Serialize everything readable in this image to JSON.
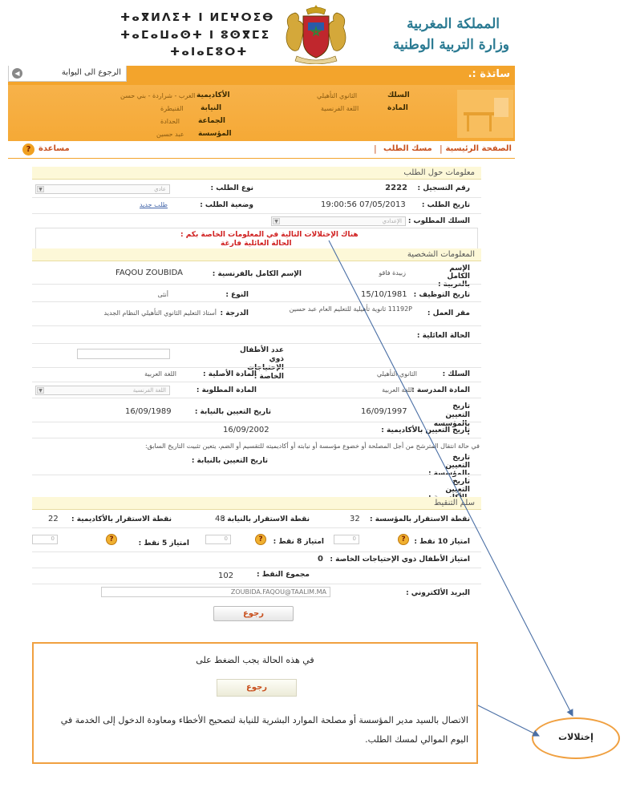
{
  "header": {
    "tifinagh_line1": "ⵜⴰⴳⵍⴷⵉⵜ ⵏ ⵍⵎⵖⵔⵉⴱ",
    "tifinagh_line2": "ⵜⴰⵎⴰⵡⴰⵙⵜ ⵏ ⵓⵙⴳⵎⵉ",
    "tifinagh_line3": "ⵜⴰⵏⴰⵎⵓⵔⵜ",
    "kingdom": "المملكة المغربية",
    "ministry": "وزارة التربية الوطنية"
  },
  "topbar": {
    "back_to_portal": "الرجوع الى البوابة",
    "title": "ساتذة :."
  },
  "info": {
    "academy_label": "الأكاديمية",
    "academy_value": "الغرب - شراردة - بني حسن",
    "province_label": "النيابة",
    "province_value": "القنيطرة",
    "commune_label": "الجماعة",
    "commune_value": "الحدادة",
    "school_label": "المؤسسة",
    "school_value": "عبد حسين",
    "cycle_label": "السلك",
    "cycle_value": "الثانوي التأهيلي",
    "subject_label": "المادة",
    "subject_value": "اللغة الفرنسية"
  },
  "nav": {
    "home": "الصفحة الرئيسية",
    "sep": "|",
    "track": "مسك الطلب",
    "help": "مساعدة"
  },
  "form": {
    "section_request": "معلومات حول الطلب",
    "reg_no_label": "رقم التسجيل :",
    "reg_no_value": "2222",
    "request_type_label": "نوع الطلب :",
    "request_type_value": "عادي",
    "request_date_label": "تاريخ الطلب :",
    "request_date_value": "19:00:56 07/05/2013",
    "request_status_label": "وضعية الطلب :",
    "request_status_value": "طلب جديد",
    "requested_cycle_label": "السلك المطلوب :",
    "requested_cycle_value": "الإعدادي",
    "error_line1": "هناك الإختلالات التالية في المعلومات الخاصة بكم :",
    "error_line2": "الحالة العائلية فارغة",
    "section_personal": "المعلومات الشخصية",
    "name_ar_label": "الإسم الكامل بالعربية :",
    "name_ar_value": "زبيدة فاقو",
    "name_fr_label": "الإسم الكامل بالفرنسية :",
    "name_fr_value": "FAQOU ZOUBIDA",
    "hire_date_label": "تاريخ التوظيف :",
    "hire_date_value": "15/10/1981",
    "gender_label": "النوع :",
    "gender_value": "أنثى",
    "workplace_label": "مقر العمل :",
    "workplace_value": "11192P ثانوية تأهيلية للتعليم العام عبد حسين",
    "grade_label": "الدرجة :",
    "grade_value": "أستاذ التعليم الثانوي التأهيلي النظام الجديد",
    "marital_label": "الحالة العائلية :",
    "special_needs_label": "عدد الأطفال ذوي الإحتياجات الخاصة :",
    "cycle_label": "السلك :",
    "cycle_value": "الثانوي التأهيلي",
    "orig_subject_label": "المادة الأصلية :",
    "orig_subject_value": "اللغة العربية",
    "taught_subject_label": "المادة المدرسة :",
    "taught_subject_value": "اللغة العربية",
    "req_subject_label": "المادة المطلوبة :",
    "req_subject_value": "اللغة الفرنسية",
    "assign_school_label": "تاريخ التعيين بالمؤسسة :",
    "assign_school_value": "16/09/1997",
    "assign_prov_label": "تاريخ التعيين بالنيابة :",
    "assign_prov_value": "16/09/1989",
    "assign_acad_label": "تاريخ التعيين بالأكاديمية :",
    "assign_acad_value": "16/09/2002",
    "move_note": "في حالة انتقال المترشح من أجل المصلحة أو خضوع مؤسسة أو نيابته أو أكاديميته للتقسيم أو الضم، يتعين تثبيت التاريخ السابق:",
    "assign_school2_label": "تاريخ التعيين بالمؤسسة :",
    "assign_prov2_label": "تاريخ التعيين بالنيابة :",
    "assign_acad2_label": "تاريخ التعيين بالأكاديمية :",
    "section_score": "سلم التنقيط",
    "stab_school_label": "نقطة الاستقرار بالمؤسسة :",
    "stab_school_value": "32",
    "stab_prov_label": "نقطة الاستقرار بالنيابة :",
    "stab_prov_value": "48",
    "stab_acad_label": "نقطة الاستقرار بالأكاديمية :",
    "stab_acad_value": "22",
    "priv10_label": "امتياز 10 نقط :",
    "priv8_label": "امتياز 8 نقط :",
    "priv5_label": "امتياز 5 نقط :",
    "priv_value": "0",
    "special_priv_label": "امتياز الأطفال ذوي الإحتياجات الخاصة :",
    "special_priv_value": "0",
    "total_label": "مجموع النقط :",
    "total_value": "102",
    "email_label": "البريد الألكتروني :",
    "email_value": "ZOUBIDA.FAQOU@TAALIM.MA",
    "back_button": "رجوع",
    "help_icon": "?"
  },
  "callout": {
    "line1": "في هذه الحالة يجب الضغط على",
    "button": "رجوع",
    "line2": "الاتصال بالسيد مدير المؤسسة أو مصلحة الموارد البشرية للنيابة لتصحيح الأخطاء ومعاودة الدخول إلى الخدمة في اليوم الموالي لمسك الطلب."
  },
  "bubble": {
    "text": "إختلالات"
  },
  "colors": {
    "orange": "#f3a42c",
    "title_teal": "#2a7a92",
    "error_red": "#d02020",
    "callout_border": "#f0a040",
    "arrow_blue": "#4a6fa5"
  }
}
